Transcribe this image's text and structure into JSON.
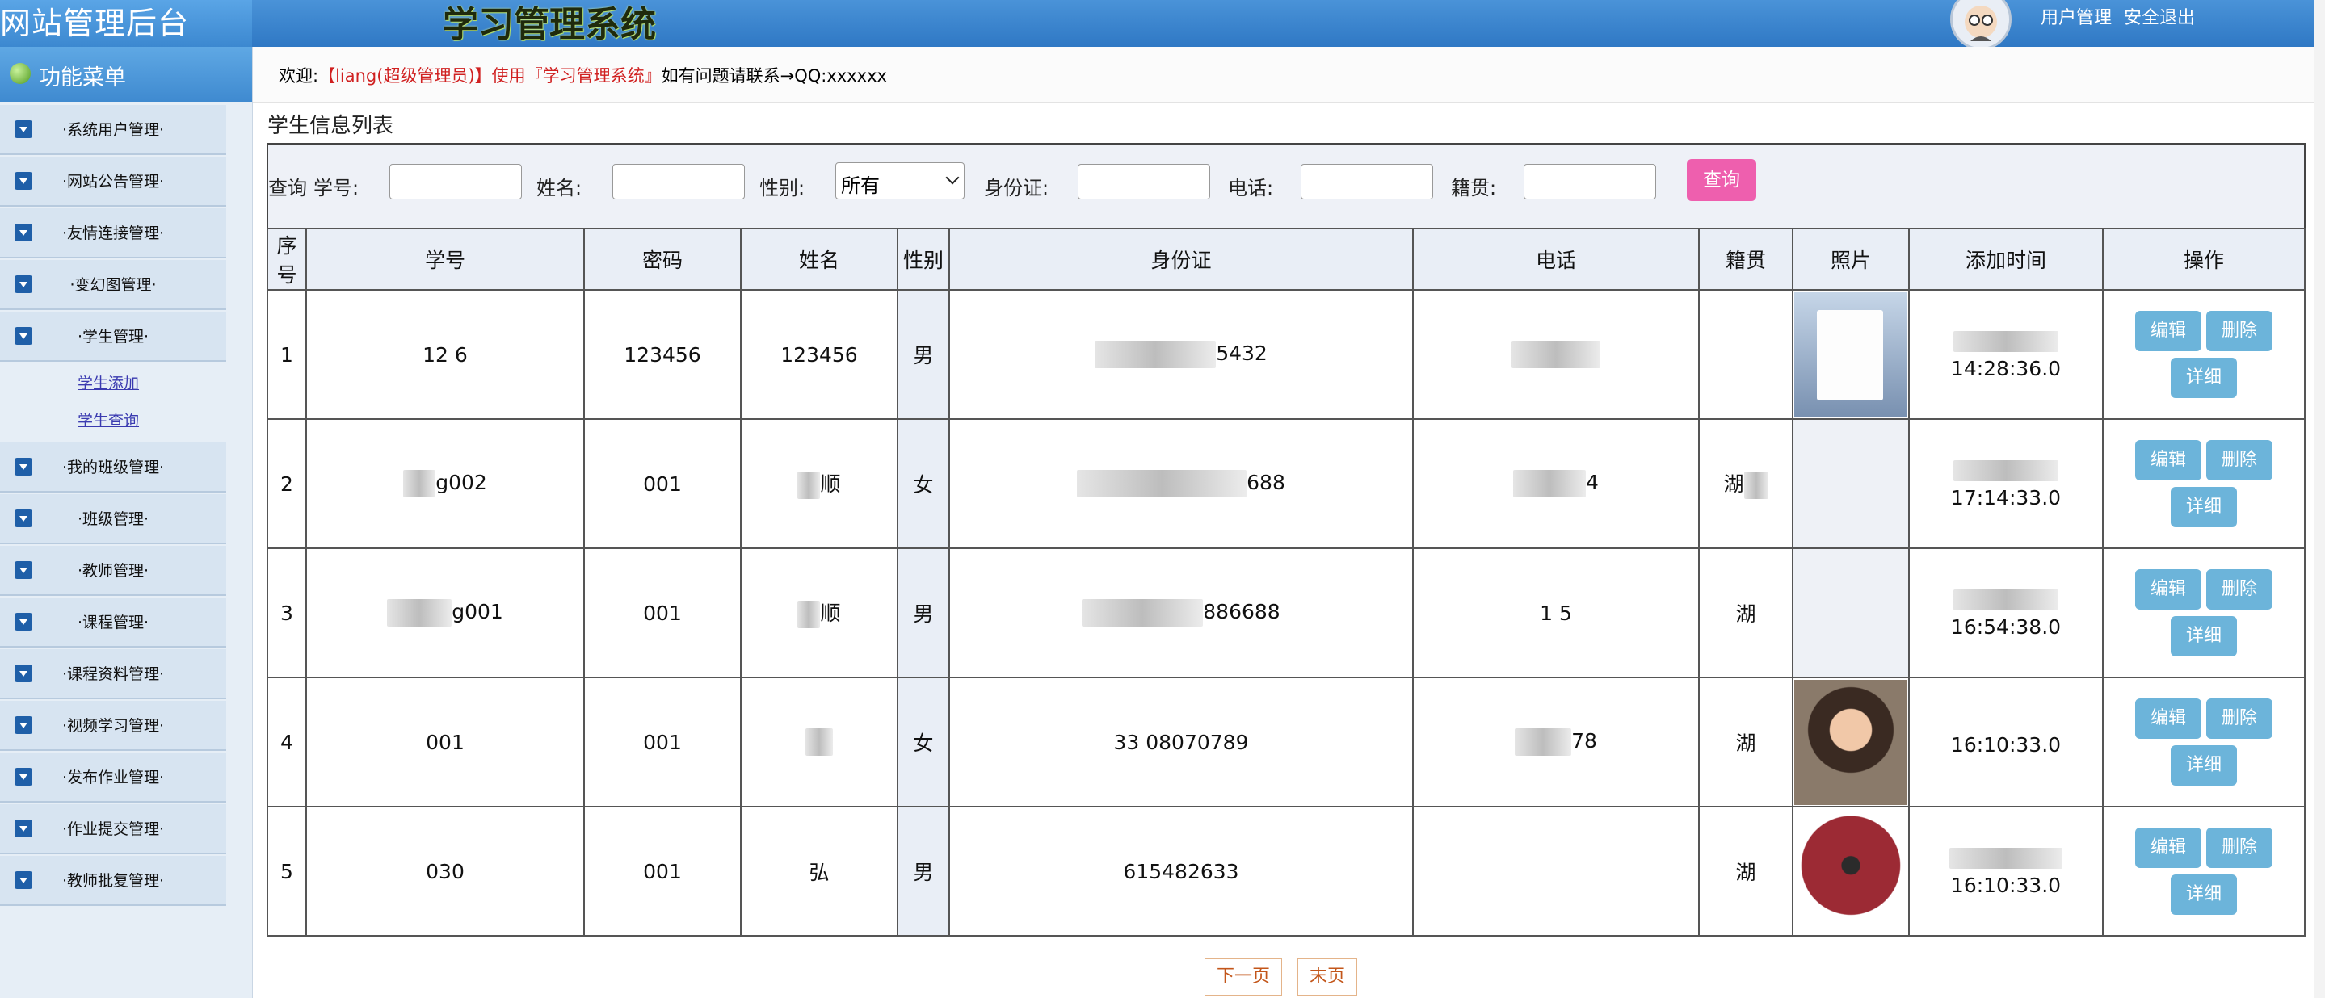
{
  "header": {
    "site_title": "网站管理后台",
    "system_title": "学习管理系统",
    "user_mgmt": "用户管理",
    "logout": "安全退出"
  },
  "sidebar": {
    "title": "功能菜单",
    "items": [
      {
        "label": "·系统用户管理·"
      },
      {
        "label": "·网站公告管理·"
      },
      {
        "label": "·友情连接管理·"
      },
      {
        "label": "·变幻图管理·"
      },
      {
        "label": "·学生管理·",
        "children": [
          {
            "label": "学生添加"
          },
          {
            "label": "学生查询"
          }
        ]
      },
      {
        "label": "·我的班级管理·"
      },
      {
        "label": "·班级管理·"
      },
      {
        "label": "·教师管理·"
      },
      {
        "label": "·课程管理·"
      },
      {
        "label": "·课程资料管理·"
      },
      {
        "label": "·视频学习管理·"
      },
      {
        "label": "·发布作业管理·"
      },
      {
        "label": "·作业提交管理·"
      },
      {
        "label": "·教师批复管理·"
      }
    ]
  },
  "welcome": {
    "prefix": "欢迎:",
    "user": "【liang(超级管理员)】",
    "mid": "使用",
    "system": "『学习管理系统』",
    "suffix": "如有问题请联系→QQ:xxxxxx"
  },
  "page": {
    "list_title": "学生信息列表"
  },
  "query": {
    "prefix": "查询",
    "student_no_label": "学号:",
    "name_label": "姓名:",
    "gender_label": "性别:",
    "gender_value": "所有",
    "idcard_label": "身份证:",
    "phone_label": "电话:",
    "hometown_label": "籍贯:",
    "submit": "查询"
  },
  "table": {
    "headers": [
      "序号",
      "学号",
      "密码",
      "姓名",
      "性别",
      "身份证",
      "电话",
      "籍贯",
      "照片",
      "添加时间",
      "操作"
    ],
    "rows": [
      {
        "index": "1",
        "student_no": "12  6",
        "password": "123456",
        "name": "123456",
        "gender": "男",
        "idcard": "5432",
        "phone": "",
        "hometown": "",
        "photo": "app-screenshot",
        "time": "14:28:36.0"
      },
      {
        "index": "2",
        "student_no": "g002",
        "password": "001",
        "name": "顺",
        "gender": "女",
        "idcard": "688",
        "phone": "4",
        "hometown": "湖",
        "photo": "",
        "time": "17:14:33.0"
      },
      {
        "index": "3",
        "student_no": "g001",
        "password": "001",
        "name": "顺",
        "gender": "男",
        "idcard": "886688",
        "phone": "1  5",
        "hometown": "湖",
        "photo": "",
        "time": "16:54:38.0"
      },
      {
        "index": "4",
        "student_no": "001",
        "password": "001",
        "name": "",
        "gender": "女",
        "idcard": "33  08070789",
        "phone": "78",
        "hometown": "湖",
        "photo": "girl-portrait",
        "time": "16:10:33.0"
      },
      {
        "index": "5",
        "student_no": "030",
        "password": "001",
        "name": "弘",
        "gender": "男",
        "idcard": "615482633",
        "phone": "",
        "hometown": "湖",
        "photo": "cartoon-frog",
        "time": "16:10:33.0"
      }
    ],
    "action_edit": "编辑",
    "action_delete": "删除",
    "action_detail": "详细"
  },
  "pager": {
    "next": "下一页",
    "last": "末页"
  },
  "colors": {
    "header_blue": "#2f78c4",
    "query_button": "#ee5fae",
    "action_button": "#6cb4da",
    "welcome_red": "#d02020"
  }
}
